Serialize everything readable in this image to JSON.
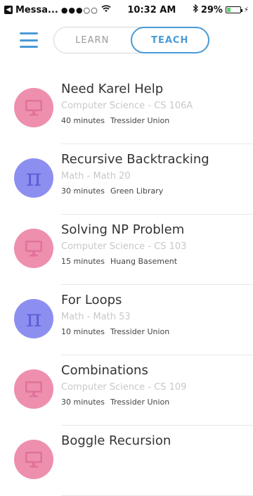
{
  "status_bar": {
    "carrier": "Messa...",
    "signal": "●●●○○",
    "wifi": "wifi-icon",
    "time": "10:32 AM",
    "bluetooth": "bluetooth-icon",
    "battery_percent": "29%",
    "battery_level": 0.29,
    "battery_color": "#4cd964"
  },
  "header": {
    "menu_icon": "hamburger-icon",
    "tabs": [
      {
        "label": "LEARN",
        "active": false
      },
      {
        "label": "TEACH",
        "active": true
      }
    ],
    "accent_color": "#4a9bd6"
  },
  "requests": [
    {
      "title": "Need Karel Help",
      "subject": "Computer Science - CS 106A",
      "duration": "40 minutes",
      "location": "Tressider Union",
      "icon": "monitor-icon",
      "avatar_color": "#ee8fae"
    },
    {
      "title": "Recursive Backtracking",
      "subject": "Math - Math 20",
      "duration": "30 minutes",
      "location": "Green Library",
      "icon": "pi-icon",
      "avatar_color": "#8d8ff0"
    },
    {
      "title": "Solving NP Problem",
      "subject": "Computer Science - CS 103",
      "duration": "15 minutes",
      "location": "Huang Basement",
      "icon": "monitor-icon",
      "avatar_color": "#ee8fae"
    },
    {
      "title": "For Loops",
      "subject": "Math - Math 53",
      "duration": "10 minutes",
      "location": "Tressider Union",
      "icon": "pi-icon",
      "avatar_color": "#8d8ff0"
    },
    {
      "title": "Combinations",
      "subject": "Computer Science - CS 109",
      "duration": "30 minutes",
      "location": "Tressider Union",
      "icon": "monitor-icon",
      "avatar_color": "#ee8fae"
    },
    {
      "title": "Boggle Recursion",
      "subject": "",
      "duration": "",
      "location": "",
      "icon": "monitor-icon",
      "avatar_color": "#ee8fae"
    }
  ]
}
